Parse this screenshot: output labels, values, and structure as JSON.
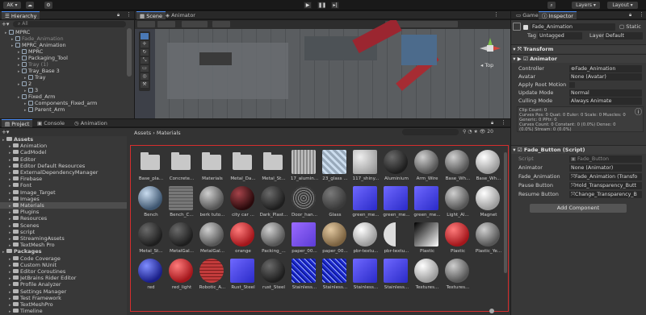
{
  "toolbar": {
    "account": "AK",
    "layers": "Layers",
    "layout": "Layout"
  },
  "hierarchy": {
    "tab": "Hierarchy",
    "search_placeholder": "All",
    "items": [
      {
        "label": "MPRC",
        "dim": false
      },
      {
        "label": "Fade_Animation",
        "dim": true
      },
      {
        "label": "MPRC_Animation",
        "dim": false
      },
      {
        "label": "MPRC",
        "dim": false
      },
      {
        "label": "Packaging_Tool",
        "dim": false
      },
      {
        "label": "Tray (1)",
        "dim": true
      },
      {
        "label": "Tray_Base 3",
        "dim": false
      },
      {
        "label": "Tray",
        "dim": false
      },
      {
        "label": "2",
        "dim": false
      },
      {
        "label": "3",
        "dim": false
      },
      {
        "label": "Fixed_Arm",
        "dim": false
      },
      {
        "label": "Components_Fixed_arm",
        "dim": false
      },
      {
        "label": "Parent_Arm",
        "dim": false
      }
    ]
  },
  "scene": {
    "tab_scene": "Scene",
    "tab_animator": "Animator",
    "persp_label": "Top"
  },
  "project": {
    "tab_project": "Project",
    "tab_console": "Console",
    "tab_animation": "Animation",
    "breadcrumb_root": "Assets",
    "breadcrumb_current": "Materials",
    "tree": [
      {
        "label": "Assets",
        "bold": true,
        "indent": 0
      },
      {
        "label": "Animation",
        "bold": false,
        "indent": 1
      },
      {
        "label": "CadModel",
        "bold": false,
        "indent": 1
      },
      {
        "label": "Editor",
        "bold": false,
        "indent": 1
      },
      {
        "label": "Editor Default Resources",
        "bold": false,
        "indent": 1
      },
      {
        "label": "ExternalDependencyManager",
        "bold": false,
        "indent": 1
      },
      {
        "label": "Firebase",
        "bold": false,
        "indent": 1
      },
      {
        "label": "Font",
        "bold": false,
        "indent": 1
      },
      {
        "label": "Image_Target",
        "bold": false,
        "indent": 1
      },
      {
        "label": "Images",
        "bold": false,
        "indent": 1
      },
      {
        "label": "Materials",
        "bold": false,
        "indent": 1,
        "selected": true
      },
      {
        "label": "Plugins",
        "bold": false,
        "indent": 1
      },
      {
        "label": "Resources",
        "bold": false,
        "indent": 1
      },
      {
        "label": "Scenes",
        "bold": false,
        "indent": 1
      },
      {
        "label": "script",
        "bold": false,
        "indent": 1
      },
      {
        "label": "StreamingAssets",
        "bold": false,
        "indent": 1
      },
      {
        "label": "TextMesh Pro",
        "bold": false,
        "indent": 1
      },
      {
        "label": "Packages",
        "bold": true,
        "indent": 0
      },
      {
        "label": "Code Coverage",
        "bold": false,
        "indent": 1
      },
      {
        "label": "Custom NUnit",
        "bold": false,
        "indent": 1
      },
      {
        "label": "Editor Coroutines",
        "bold": false,
        "indent": 1
      },
      {
        "label": "JetBrains Rider Editor",
        "bold": false,
        "indent": 1
      },
      {
        "label": "Profile Analyzer",
        "bold": false,
        "indent": 1
      },
      {
        "label": "Settings Manager",
        "bold": false,
        "indent": 1
      },
      {
        "label": "Test Framework",
        "bold": false,
        "indent": 1
      },
      {
        "label": "TextMeshPro",
        "bold": false,
        "indent": 1
      },
      {
        "label": "Timeline",
        "bold": false,
        "indent": 1
      }
    ],
    "assets": [
      {
        "label": "Base_pla...",
        "kind": "folder"
      },
      {
        "label": "Concrete...",
        "kind": "folder"
      },
      {
        "label": "Materials",
        "kind": "folder"
      },
      {
        "label": "Metal_Da...",
        "kind": "folder"
      },
      {
        "label": "Metal_St...",
        "kind": "folder"
      },
      {
        "label": "17_alumin...",
        "kind": "stripes"
      },
      {
        "label": "23_glass ...",
        "kind": "glass"
      },
      {
        "label": "117_shiny...",
        "kind": "noise"
      },
      {
        "label": "Aluminium",
        "kind": "dark"
      },
      {
        "label": "Arm_Wire",
        "kind": "grey"
      },
      {
        "label": "Base_Wh...",
        "kind": "grey"
      },
      {
        "label": "Base_Wh...",
        "kind": "white"
      },
      {
        "label": "Bench",
        "kind": "sphereblue"
      },
      {
        "label": "Bench_C...",
        "kind": "gridgrey"
      },
      {
        "label": "berk tuto...",
        "kind": "grey"
      },
      {
        "label": "city car ...",
        "kind": "darkred"
      },
      {
        "label": "Dark_Plast...",
        "kind": "dark"
      },
      {
        "label": "Door_han...",
        "kind": "wire"
      },
      {
        "label": "Glass",
        "kind": "darkgrey"
      },
      {
        "label": "green_me...",
        "kind": "bluesq"
      },
      {
        "label": "green_me...",
        "kind": "bluesq"
      },
      {
        "label": "green_me...",
        "kind": "bluesq"
      },
      {
        "label": "Light_Al...",
        "kind": "grey"
      },
      {
        "label": "Magnet",
        "kind": "white"
      },
      {
        "label": "Metal_St...",
        "kind": "dark"
      },
      {
        "label": "MetalGal...",
        "kind": "dark"
      },
      {
        "label": "MetalGal...",
        "kind": "grey"
      },
      {
        "label": "orange",
        "kind": "redball"
      },
      {
        "label": "Packing_...",
        "kind": "grey"
      },
      {
        "label": "paper_00...",
        "kind": "purplesq"
      },
      {
        "label": "paper_00...",
        "kind": "tan"
      },
      {
        "label": "pbr-textu...",
        "kind": "white"
      },
      {
        "label": "pbr-textu...",
        "kind": "half"
      },
      {
        "label": "Plastic",
        "kind": "gradient"
      },
      {
        "label": "Plastic",
        "kind": "redball"
      },
      {
        "label": "Plastic_Ye...",
        "kind": "grey"
      },
      {
        "label": "red",
        "kind": "bluesphere"
      },
      {
        "label": "red_light",
        "kind": "redball"
      },
      {
        "label": "Robotic_A...",
        "kind": "redgrid"
      },
      {
        "label": "Rust_Steel",
        "kind": "bluesq"
      },
      {
        "label": "rust_Steel",
        "kind": "dark"
      },
      {
        "label": "Stainless...",
        "kind": "noiseblue"
      },
      {
        "label": "Stainless...",
        "kind": "noiseblue"
      },
      {
        "label": "Stainless...",
        "kind": "bluesq"
      },
      {
        "label": "Stainless...",
        "kind": "bluesq"
      },
      {
        "label": "Textures...",
        "kind": "white"
      },
      {
        "label": "Textures...",
        "kind": "grey"
      }
    ]
  },
  "inspector": {
    "tab_game": "Game",
    "tab_inspector": "Inspector",
    "object_name": "Fade_Animation",
    "static_label": "Static",
    "tag_label": "Tag",
    "tag_value": "Untagged",
    "layer_label": "Layer",
    "layer_value": "Default",
    "transform_label": "Transform",
    "animator_label": "Animator",
    "controller_label": "Controller",
    "controller_value": "Fade_Animation",
    "avatar_label": "Avatar",
    "avatar_value": "None (Avatar)",
    "apply_root_label": "Apply Root Motion",
    "update_mode_label": "Update Mode",
    "update_mode_value": "Normal",
    "culling_label": "Culling Mode",
    "culling_value": "Always Animate",
    "info_lines": [
      "Clip Count: 0",
      "Curves Pos: 0 Quat: 0 Euler: 0 Scale: 0 Muscles: 0",
      "Generic: 0 PPtr: 0",
      "Curves Count: 0 Constant: 0 (0.0%) Dense: 0",
      "(0.0%) Stream: 0 (0.0%)"
    ],
    "fade_button_label": "Fade_Button (Script)",
    "script_label": "Script",
    "script_value": "Fade_Button",
    "f_animator_label": "Animator",
    "f_animator_value": "None (Animator)",
    "f_fade_label": "Fade_Animation",
    "f_fade_value": "Fade_Animation (Transfo",
    "pause_label": "Pause Button",
    "pause_value": "Hold_Transparency_Butt",
    "resume_label": "Resume Button",
    "resume_value": "Change_Transparency_B",
    "add_component": "Add Component"
  }
}
